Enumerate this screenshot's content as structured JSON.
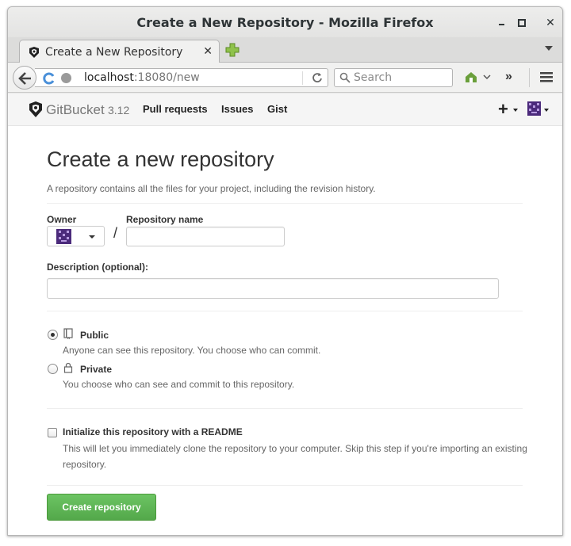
{
  "window": {
    "title": "Create a New Repository - Mozilla Firefox"
  },
  "tabs": [
    {
      "label": "Create a New Repository",
      "active": true
    }
  ],
  "navbar": {
    "url_host": "localhost",
    "url_rest": ":18080/new",
    "search_placeholder": "Search"
  },
  "header": {
    "brand": "GitBucket",
    "version": "3.12",
    "links": [
      "Pull requests",
      "Issues",
      "Gist"
    ]
  },
  "form": {
    "heading": "Create a new repository",
    "lead": "A repository contains all the files for your project, including the revision history.",
    "owner_label": "Owner",
    "separator": "/",
    "repo_name_label": "Repository name",
    "repo_name_value": "",
    "description_label": "Description (optional):",
    "description_value": "",
    "visibility": [
      {
        "title": "Public",
        "description": "Anyone can see this repository. You choose who can commit.",
        "selected": true,
        "icon": "repo-icon"
      },
      {
        "title": "Private",
        "description": "You choose who can see and commit to this repository.",
        "selected": false,
        "icon": "lock-icon"
      }
    ],
    "readme_label": "Initialize this repository with a README",
    "readme_checked": false,
    "readme_description": "This will let you immediately clone the repository to your computer. Skip this step if you're importing an existing repository.",
    "submit_label": "Create repository"
  },
  "colors": {
    "submit_button": "#5cb85c",
    "avatar": "#4b2a7b"
  }
}
